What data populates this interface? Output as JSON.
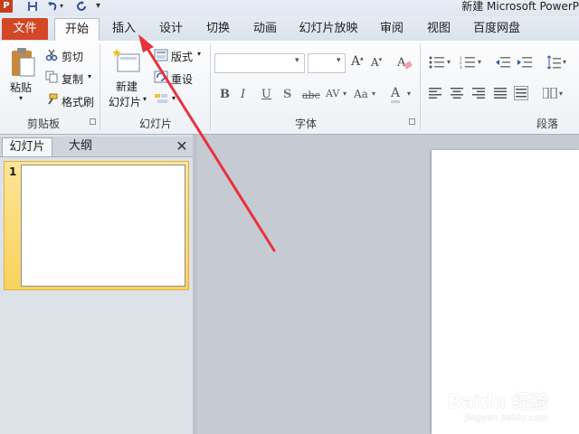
{
  "window_title": "新建 Microsoft PowerP",
  "app_letter": "P",
  "tabs": {
    "file": "文件",
    "home": "开始",
    "insert": "插入",
    "design": "设计",
    "transitions": "切换",
    "animations": "动画",
    "slideshow": "幻灯片放映",
    "review": "审阅",
    "view": "视图",
    "baidu": "百度网盘"
  },
  "clipboard": {
    "paste": "粘贴",
    "cut": "剪切",
    "copy": "复制",
    "format_painter": "格式刷",
    "group_label": "剪贴板"
  },
  "slides_group": {
    "new_slide_line1": "新建",
    "new_slide_line2": "幻灯片",
    "layout": "版式",
    "reset": "重设",
    "group_label": "幻灯片"
  },
  "font_group": {
    "group_label": "字体"
  },
  "paragraph_group": {
    "group_label": "段落"
  },
  "panel": {
    "tab_slides": "幻灯片",
    "tab_outline": "大纲",
    "close": "✕",
    "slide_number": "1"
  },
  "watermark": {
    "main": "Baidu 经验",
    "sub": "jingyan.baidu.com"
  },
  "colors": {
    "file_tab": "#d24726",
    "selection": "#f9d25d",
    "arrow": "#e8323c"
  }
}
